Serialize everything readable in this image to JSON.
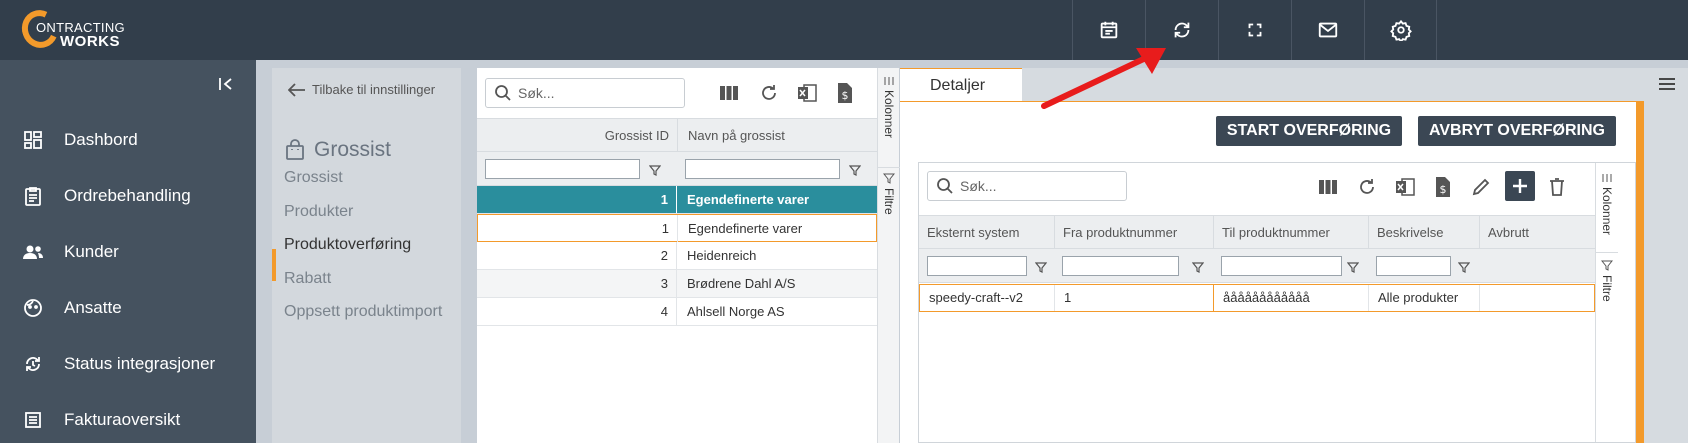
{
  "topbar": {
    "logo_top": "ONTRACTING",
    "logo_bottom": "WORKS",
    "icons": [
      "calendar-icon",
      "sync-icon",
      "fullscreen-icon",
      "mail-icon",
      "settings-icon"
    ]
  },
  "nav": {
    "items": [
      {
        "label": "Dashbord",
        "icon": "dashboard-icon"
      },
      {
        "label": "Ordrebehandling",
        "icon": "clipboard-icon"
      },
      {
        "label": "Kunder",
        "icon": "users-icon"
      },
      {
        "label": "Ansatte",
        "icon": "face-icon"
      },
      {
        "label": "Status integrasjoner",
        "icon": "integration-icon"
      },
      {
        "label": "Fakturaoversikt",
        "icon": "list-icon"
      }
    ]
  },
  "settings": {
    "back_label": "Tilbake til innstillinger",
    "title": "Grossist",
    "items": [
      {
        "label": "Grossist",
        "active": false
      },
      {
        "label": "Produkter",
        "active": false
      },
      {
        "label": "Produktoverføring",
        "active": true
      },
      {
        "label": "Rabatt",
        "active": false
      },
      {
        "label": "Oppsett produktimport",
        "active": false
      }
    ]
  },
  "grid": {
    "search_placeholder": "Søk...",
    "columns": [
      "Grossist ID",
      "Navn på grossist"
    ],
    "rows": [
      {
        "id": "1",
        "name": "Egendefinerte varer",
        "state": "selected"
      },
      {
        "id": "1",
        "name": "Egendefinerte varer",
        "state": "focused"
      },
      {
        "id": "2",
        "name": "Heidenreich",
        "state": ""
      },
      {
        "id": "3",
        "name": "Brødrene Dahl A/S",
        "state": ""
      },
      {
        "id": "4",
        "name": "Ahlsell Norge AS",
        "state": ""
      }
    ],
    "side_tabs": [
      "Kolonner",
      "Filtre"
    ]
  },
  "details": {
    "tab_label": "Detaljer",
    "start_button": "START OVERFØRING",
    "cancel_button": "AVBRYT OVERFØRING",
    "search_placeholder": "Søk...",
    "columns": [
      "Eksternt system",
      "Fra produktnummer",
      "Til produktnummer",
      "Beskrivelse",
      "Avbrutt"
    ],
    "rows": [
      {
        "system": "speedy-craft--v2",
        "from": "1",
        "to": "åååååååååååå",
        "desc": "Alle produkter",
        "cancelled": ""
      }
    ],
    "side_tabs": [
      "Kolonner",
      "Filtre"
    ]
  },
  "colors": {
    "accent": "#f39a2b",
    "topbar": "#323e4b",
    "nav": "#45525f",
    "selected_row": "#2a8e9d",
    "annotation_arrow": "#e81c1c"
  }
}
